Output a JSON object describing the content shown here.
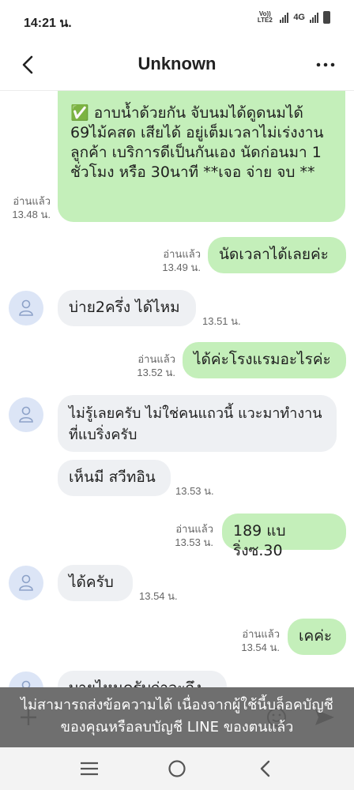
{
  "status": {
    "time": "14:21 น.",
    "volte": "Vo)) LTE2",
    "network": "4G"
  },
  "header": {
    "title": "Unknown"
  },
  "messages": [
    {
      "text": "✅ อาบน้ำด้วยกัน จับนมได้ดูดนมได้ 69ไม้คสด เสียได้ อยู่เต็มเวลาไม่เร่งงาน ลูกค้า เบริการดีเป็นกันเอง นัดก่อนมา 1 ชั่วโมง หรือ 30นาที **เจอ จ่าย จบ **",
      "read": "อ่านแล้ว",
      "time": "13.48 น."
    },
    {
      "text": "นัดเวลาได้เลยค่ะ",
      "read": "อ่านแล้ว",
      "time": "13.49 น."
    },
    {
      "text": "บ่าย2ครึ่ง ได้ไหม",
      "time": "13.51 น."
    },
    {
      "text": "ได้ค่ะโรงแรมอะไรค่ะ",
      "read": "อ่านแล้ว",
      "time": "13.52 น."
    },
    {
      "text": "ไม่รู้เลยครับ ไม่ใช่คนแถวนี้ แวะมาทำงานที่แบริ่งครับ"
    },
    {
      "text": "เห็นมี สวีทอิน",
      "time": "13.53 น."
    },
    {
      "text": "189 แบริ่งซ.30",
      "read": "อ่านแล้ว",
      "time": "13.53 น."
    },
    {
      "text": "ได้ครับ",
      "time": "13.54 น."
    },
    {
      "text": "เคค่ะ",
      "read": "อ่านแล้ว",
      "time": "13.54 น."
    },
    {
      "text": "บายไหนครับถ่าจะถึง"
    }
  ],
  "notice": {
    "line1": "ไม่สามารถส่งข้อความได้ เนื่องจากผู้ใช้นี้บล็อคบัญชี",
    "line2": "ของคุณหรือลบบัญชี LINE ของตนแล้ว"
  },
  "icons": {
    "back": "back-arrow-icon",
    "more": "more-icon",
    "add": "plus-icon",
    "emoji": "emoji-icon",
    "send": "send-icon",
    "avatar": "user-avatar-icon"
  },
  "colors": {
    "outgoing": "#c4efba",
    "incoming": "#eef0f3",
    "notice": "#5f5f5f"
  }
}
